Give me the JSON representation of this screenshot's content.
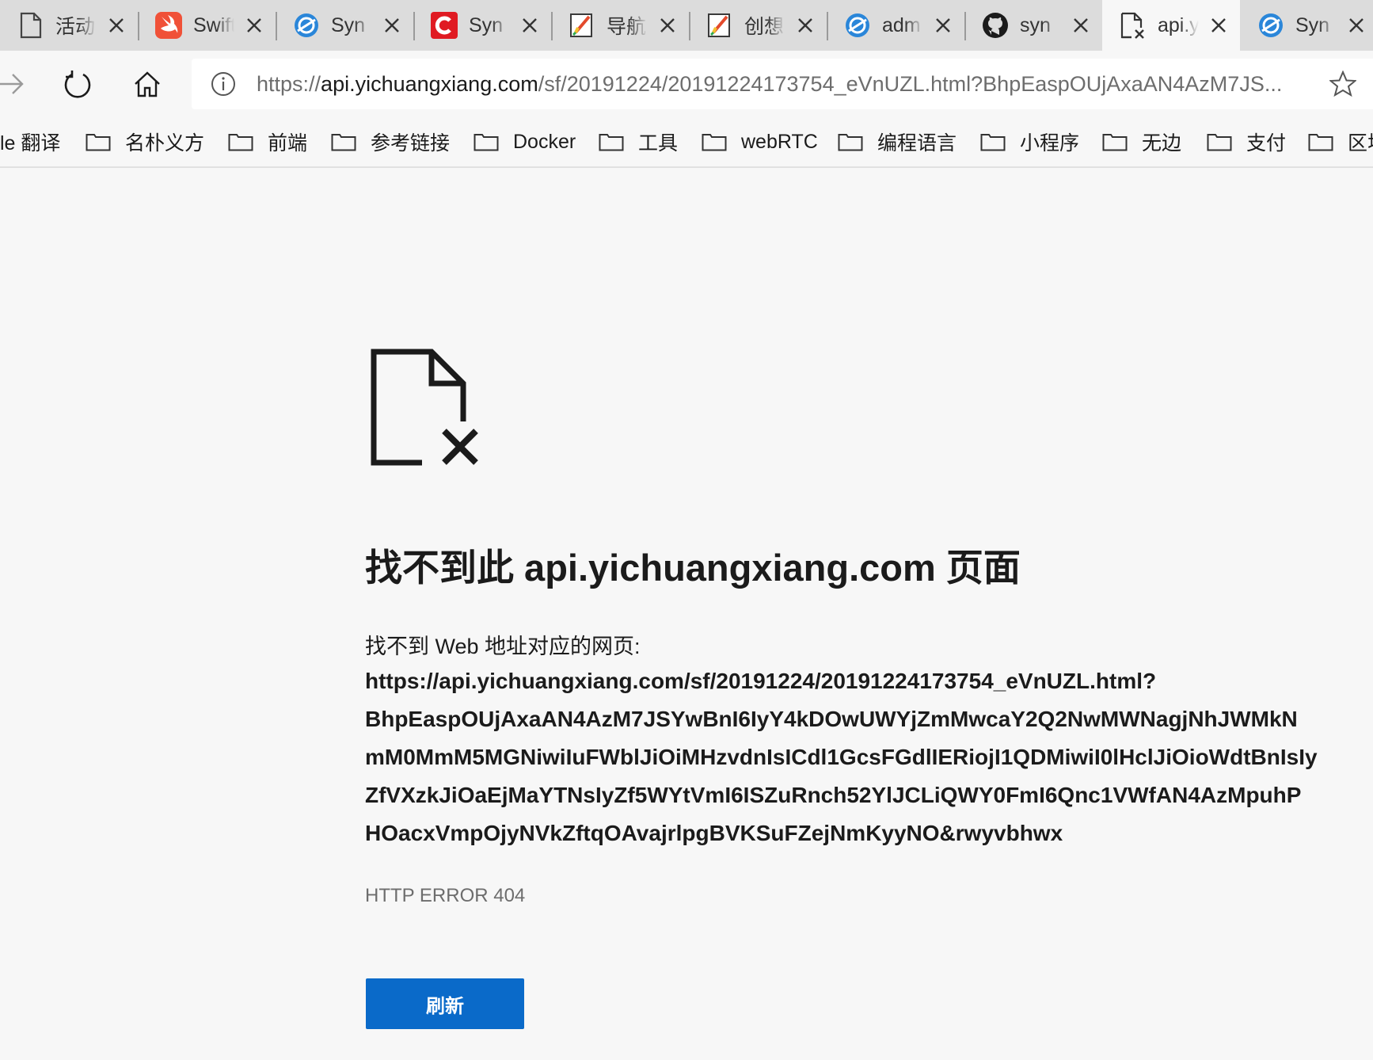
{
  "tabs": [
    {
      "title": "活动",
      "icon": "blank-page-icon"
    },
    {
      "title": "Swift",
      "icon": "swift-logo-icon"
    },
    {
      "title": "Syn",
      "icon": "browser-globe-icon"
    },
    {
      "title": "Syn",
      "icon": "red-c-logo-icon"
    },
    {
      "title": "导航",
      "icon": "notepad-pencil-icon"
    },
    {
      "title": "创想",
      "icon": "notepad-pencil-icon"
    },
    {
      "title": "adm",
      "icon": "browser-globe-icon"
    },
    {
      "title": "syn",
      "icon": "github-icon"
    },
    {
      "title": "api.y",
      "icon": "error-page-icon",
      "active": true
    },
    {
      "title": "Syn",
      "icon": "browser-globe-icon"
    }
  ],
  "address": {
    "scheme": "https://",
    "host": "api.yichuangxiang.com",
    "path": "/sf/20191224/20191224173754_eVnUZL.html?BhpEaspOUjAxaAN4AzM7JS..."
  },
  "favorites": [
    {
      "label": "le 翻译",
      "folder": false
    },
    {
      "label": "名朴义方",
      "folder": true
    },
    {
      "label": "前端",
      "folder": true
    },
    {
      "label": "参考链接",
      "folder": true
    },
    {
      "label": "Docker",
      "folder": true
    },
    {
      "label": "工具",
      "folder": true
    },
    {
      "label": "webRTC",
      "folder": true
    },
    {
      "label": "编程语言",
      "folder": true
    },
    {
      "label": "小程序",
      "folder": true
    },
    {
      "label": "无边",
      "folder": true
    },
    {
      "label": "支付",
      "folder": true
    },
    {
      "label": "区块",
      "folder": true
    }
  ],
  "error": {
    "title": "找不到此 api.yichuangxiang.com 页面",
    "intro": "找不到 Web 地址对应的网页:",
    "url_lines": [
      "https://api.yichuangxiang.com/sf/20191224/20191224173754_eVnUZL.html?",
      "BhpEaspOUjAxaAN4AzM7JSYwBnI6IyY4kDOwUWYjZmMwcaY2Q2NwMWNagjNhJWMkN",
      "mM0MmM5MGNiwiIuFWblJiOiMHzvdnIsICdl1GcsFGdlIERiojI1QDMiwiI0lHclJiOioWdtBnIsIy",
      "ZfVXzkJiOaEjMaYTNsIyZf5WYtVmI6ISZuRnch52YlJCLiQWY0FmI6Qnc1VWfAN4AzMpuhP",
      "HOacxVmpOjyNVkZftqOAvajrlpgBVKSuFZejNmKyyNO&rwyvbhwx"
    ],
    "code": "HTTP ERROR 404",
    "refresh_label": "刷新"
  }
}
